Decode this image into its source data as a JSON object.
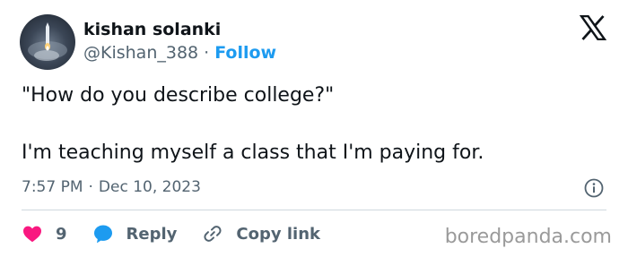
{
  "author": {
    "name": "kishan solanki",
    "handle": "@Kishan_388",
    "separator": "·",
    "follow_label": "Follow",
    "avatar_icon": "rocket-launch-avatar"
  },
  "platform_icon": "x-logo-icon",
  "tweet": {
    "lines": [
      "\"How do you describe college?\"",
      "I'm teaching myself a class that I'm paying for."
    ]
  },
  "meta": {
    "time": "7:57 PM",
    "separator": "·",
    "date": "Dec 10, 2023"
  },
  "actions": {
    "like_count": "9",
    "reply_label": "Reply",
    "copy_link_label": "Copy link"
  },
  "watermark": "boredpanda.com",
  "colors": {
    "text": "#0f1419",
    "muted": "#536471",
    "accent": "#1d9bf0",
    "like": "#f91880",
    "divider": "#cfd9de"
  }
}
